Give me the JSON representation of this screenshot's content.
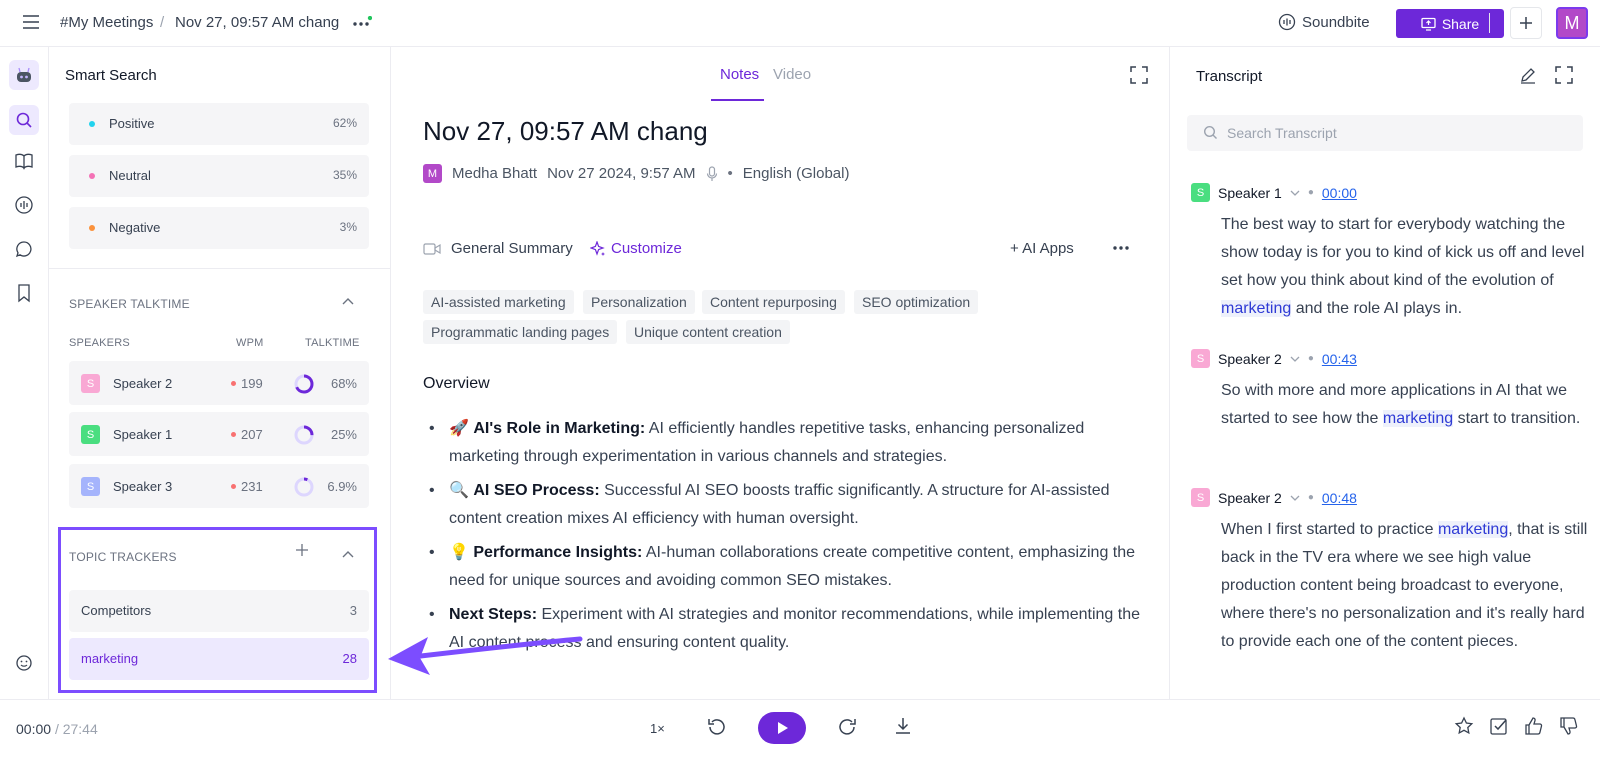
{
  "header": {
    "breadcrumb_parent": "#My Meetings",
    "breadcrumb_sep": "/",
    "breadcrumb_current": "Nov 27, 09:57 AM chang",
    "soundbite_label": "Soundbite",
    "share_label": "Share",
    "user_initial": "M"
  },
  "smart_search": {
    "title": "Smart Search",
    "sentiment": [
      {
        "label": "Positive",
        "percent": "62%",
        "color": "#22d3ee"
      },
      {
        "label": "Neutral",
        "percent": "35%",
        "color": "#f472b6"
      },
      {
        "label": "Negative",
        "percent": "3%",
        "color": "#fb923c"
      }
    ],
    "talktime": {
      "section_title": "SPEAKER TALKTIME",
      "col_speakers": "SPEAKERS",
      "col_wpm": "WPM",
      "col_talktime": "TALKTIME",
      "speakers": [
        {
          "initial": "S",
          "name": "Speaker 2",
          "wpm": "199",
          "talktime": "68%",
          "fraction": 0.68,
          "color": "#f9a8d4"
        },
        {
          "initial": "S",
          "name": "Speaker 1",
          "wpm": "207",
          "talktime": "25%",
          "fraction": 0.25,
          "color": "#4ade80"
        },
        {
          "initial": "S",
          "name": "Speaker 3",
          "wpm": "231",
          "talktime": "6.9%",
          "fraction": 0.069,
          "color": "#a5b4fc"
        }
      ]
    },
    "topics": {
      "section_title": "TOPIC TRACKERS",
      "items": [
        {
          "label": "Competitors",
          "count": "3"
        },
        {
          "label": "marketing",
          "count": "28"
        }
      ]
    }
  },
  "notes": {
    "tabs": [
      "Notes",
      "Video"
    ],
    "title": "Nov 27, 09:57 AM chang",
    "author_initial": "M",
    "author": "Medha Bhatt",
    "date": "Nov 27 2024, 9:57 AM",
    "meta_sep": "•",
    "language": "English (Global)",
    "summary_type": "General Summary",
    "customize_label": "Customize",
    "ai_apps_label": "+ AI Apps",
    "chips": [
      "AI-assisted marketing",
      "Personalization",
      "Content repurposing",
      "SEO optimization",
      "Programmatic landing pages",
      "Unique content creation"
    ],
    "overview_title": "Overview",
    "bullets": [
      {
        "emoji": "🚀",
        "title": "AI's Role in Marketing:",
        "text": " AI efficiently handles repetitive tasks, enhancing personalized marketing through experimentation in various channels and strategies."
      },
      {
        "emoji": "🔍",
        "title": "AI SEO Process:",
        "text": " Successful AI SEO boosts traffic significantly. A structure for AI-assisted content creation mixes AI efficiency with human oversight."
      },
      {
        "emoji": "💡",
        "title": "Performance Insights:",
        "text": " AI-human collaborations create competitive content, emphasizing the need for unique sources and avoiding common SEO mistakes."
      },
      {
        "emoji": "",
        "title": "Next Steps:",
        "text": " Experiment with AI strategies and monitor recommendations, while implementing the AI content process and ensuring content quality."
      }
    ]
  },
  "transcript": {
    "title": "Transcript",
    "search_placeholder": "Search Transcript",
    "entries": [
      {
        "initial": "S",
        "speaker": "Speaker 1",
        "time": "00:00",
        "color": "#4ade80",
        "before": "The best way to start for everybody watching the show today is for you to kind of kick us off and level set how you think about kind of the evolution of ",
        "highlight": "marketing",
        "after": " and the role AI plays in."
      },
      {
        "initial": "S",
        "speaker": "Speaker 2",
        "time": "00:43",
        "color": "#f9a8d4",
        "before": "So with more and more applications in AI that we started to see how the ",
        "highlight": "marketing",
        "after": " start to transition."
      },
      {
        "initial": "S",
        "speaker": "Speaker 2",
        "time": "00:48",
        "color": "#f9a8d4",
        "before": "When I first started to practice ",
        "highlight": "marketing",
        "after": ", that is still back in the TV era where we see high value production content being broadcast to everyone, where there's no personalization and it's really hard to provide each one of the content pieces."
      }
    ]
  },
  "player": {
    "current": "00:00",
    "sep": "/",
    "duration": "27:44",
    "speed": "1×"
  },
  "colors": {
    "accent": "#6d28d9",
    "highlight_box": "#7c4dff"
  }
}
